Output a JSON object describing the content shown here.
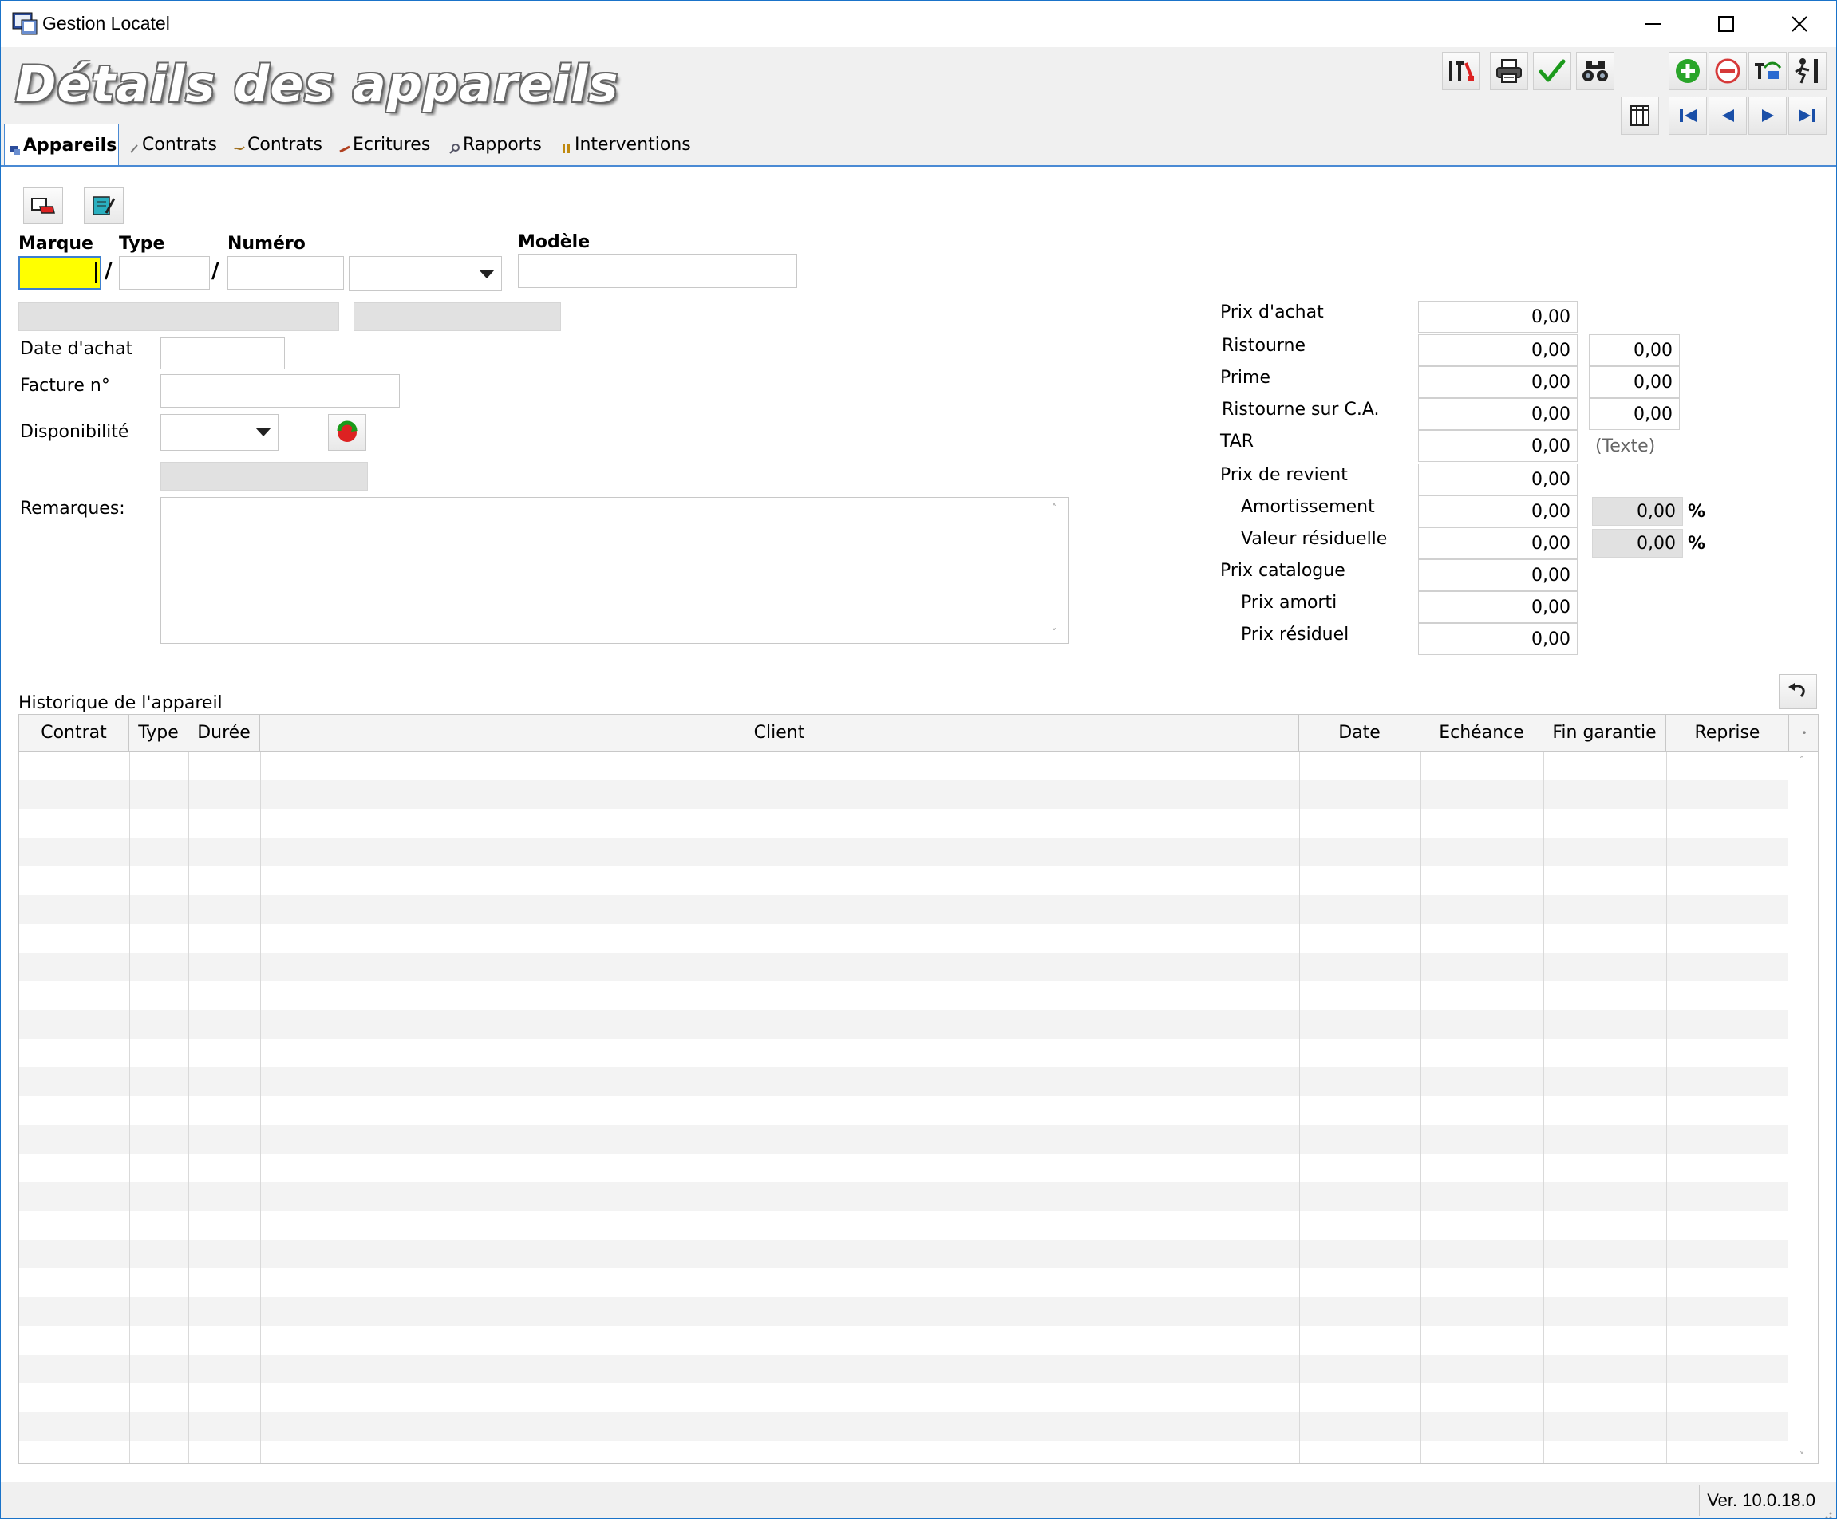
{
  "window": {
    "title": "Gestion Locatel"
  },
  "header": {
    "page_title": "Détails des appareils"
  },
  "tabs": [
    {
      "label": "Appareils",
      "active": true
    },
    {
      "label": "Contrats",
      "active": false
    },
    {
      "label": "Contrats",
      "active": false
    },
    {
      "label": "Ecritures",
      "active": false
    },
    {
      "label": "Rapports",
      "active": false
    },
    {
      "label": "Interventions",
      "active": false
    }
  ],
  "form": {
    "marque_label": "Marque",
    "type_label": "Type",
    "numero_label": "Numéro",
    "modele_label": "Modèle",
    "separator": "/",
    "date_achat_label": "Date d'achat",
    "facture_label": "Facture n°",
    "disponibilite_label": "Disponibilité",
    "remarques_label": "Remarques:"
  },
  "prices": {
    "prix_achat": {
      "label": "Prix d'achat",
      "value": "0,00"
    },
    "ristourne": {
      "label": "Ristourne",
      "value": "0,00",
      "value2": "0,00"
    },
    "prime": {
      "label": "Prime",
      "value": "0,00",
      "value2": "0,00"
    },
    "ristourne_ca": {
      "label": "Ristourne sur C.A.",
      "value": "0,00",
      "value2": "0,00"
    },
    "tar": {
      "label": "TAR",
      "value": "0,00",
      "note": "(Texte)"
    },
    "prix_revient": {
      "label": "Prix de revient",
      "value": "0,00"
    },
    "amortissement": {
      "label": "Amortissement",
      "value": "0,00",
      "pct_value": "0,00",
      "pct_sign": "%"
    },
    "valeur_residuelle": {
      "label": "Valeur résiduelle",
      "value": "0,00",
      "pct_value": "0,00",
      "pct_sign": "%"
    },
    "prix_catalogue": {
      "label": "Prix catalogue",
      "value": "0,00"
    },
    "prix_amorti": {
      "label": "Prix amorti",
      "value": "0,00"
    },
    "prix_residuel": {
      "label": "Prix résiduel",
      "value": "0,00"
    }
  },
  "history": {
    "title": "Historique de l'appareil",
    "columns": [
      "Contrat",
      "Type",
      "Durée",
      "Client",
      "Date",
      "Echéance",
      "Fin garantie",
      "Reprise"
    ]
  },
  "status": {
    "version": "Ver. 10.0.18.0"
  },
  "colors": {
    "accent": "#4a8ad4",
    "active_field": "#ffff00",
    "add_green": "#2aa52a",
    "delete_red": "#d63a3a"
  }
}
